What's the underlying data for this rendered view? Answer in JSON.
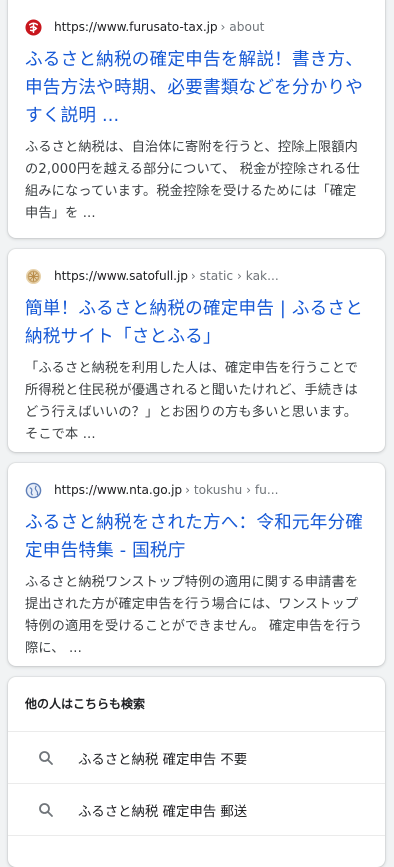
{
  "results": [
    {
      "domain": "https://www.furusato-tax.jp",
      "path": "› about",
      "title": "ふるさと納税の確定申告を解説！書き方、申告方法や時期、必要書類などを分かりやすく説明 ...",
      "snippet": "ふるさと納税は、自治体に寄附を行うと、控除上限額内の2,000円を越える部分について、 税金が控除される仕組みになっています。税金控除を受けるためには「確定申告」を ...",
      "favicon": "furusato-tax-logo-icon",
      "favicon_color": "#c8161d"
    },
    {
      "domain": "https://www.satofull.jp",
      "path": "› static › kak...",
      "title": "簡単！ふるさと納税の確定申告 | ふるさと納税サイト「さとふる」",
      "snippet": "「ふるさと納税を利用した人は、確定申告を行うことで所得税と住民税が優遇されると聞いたけれど、手続きはどう行えばいいの？」とお困りの方も多いと思います。 そこで本 ...",
      "favicon": "satofull-logo-icon",
      "favicon_color": "#c8a46a"
    },
    {
      "domain": "https://www.nta.go.jp",
      "path": "› tokushu › fu...",
      "title": "ふるさと納税をされた方へ：令和元年分確定申告特集 - 国税庁",
      "snippet": "ふるさと納税ワンストップ特例の適用に関する申請書を提出された方が確定申告を行う場合には、ワンストップ特例の適用を受けることができません。 確定申告を行う際に、 ...",
      "favicon": "globe-icon",
      "favicon_color": "#5f7fb8"
    }
  ],
  "people_also_search": {
    "header": "他の人はこちらも検索",
    "items": [
      "ふるさと納税 確定申告 不要",
      "ふるさと納税 確定申告 郵送"
    ]
  },
  "colors": {
    "background": "#f1f3f4",
    "title_link": "#1558d6",
    "url": "#202124",
    "snippet": "#3c4043"
  }
}
